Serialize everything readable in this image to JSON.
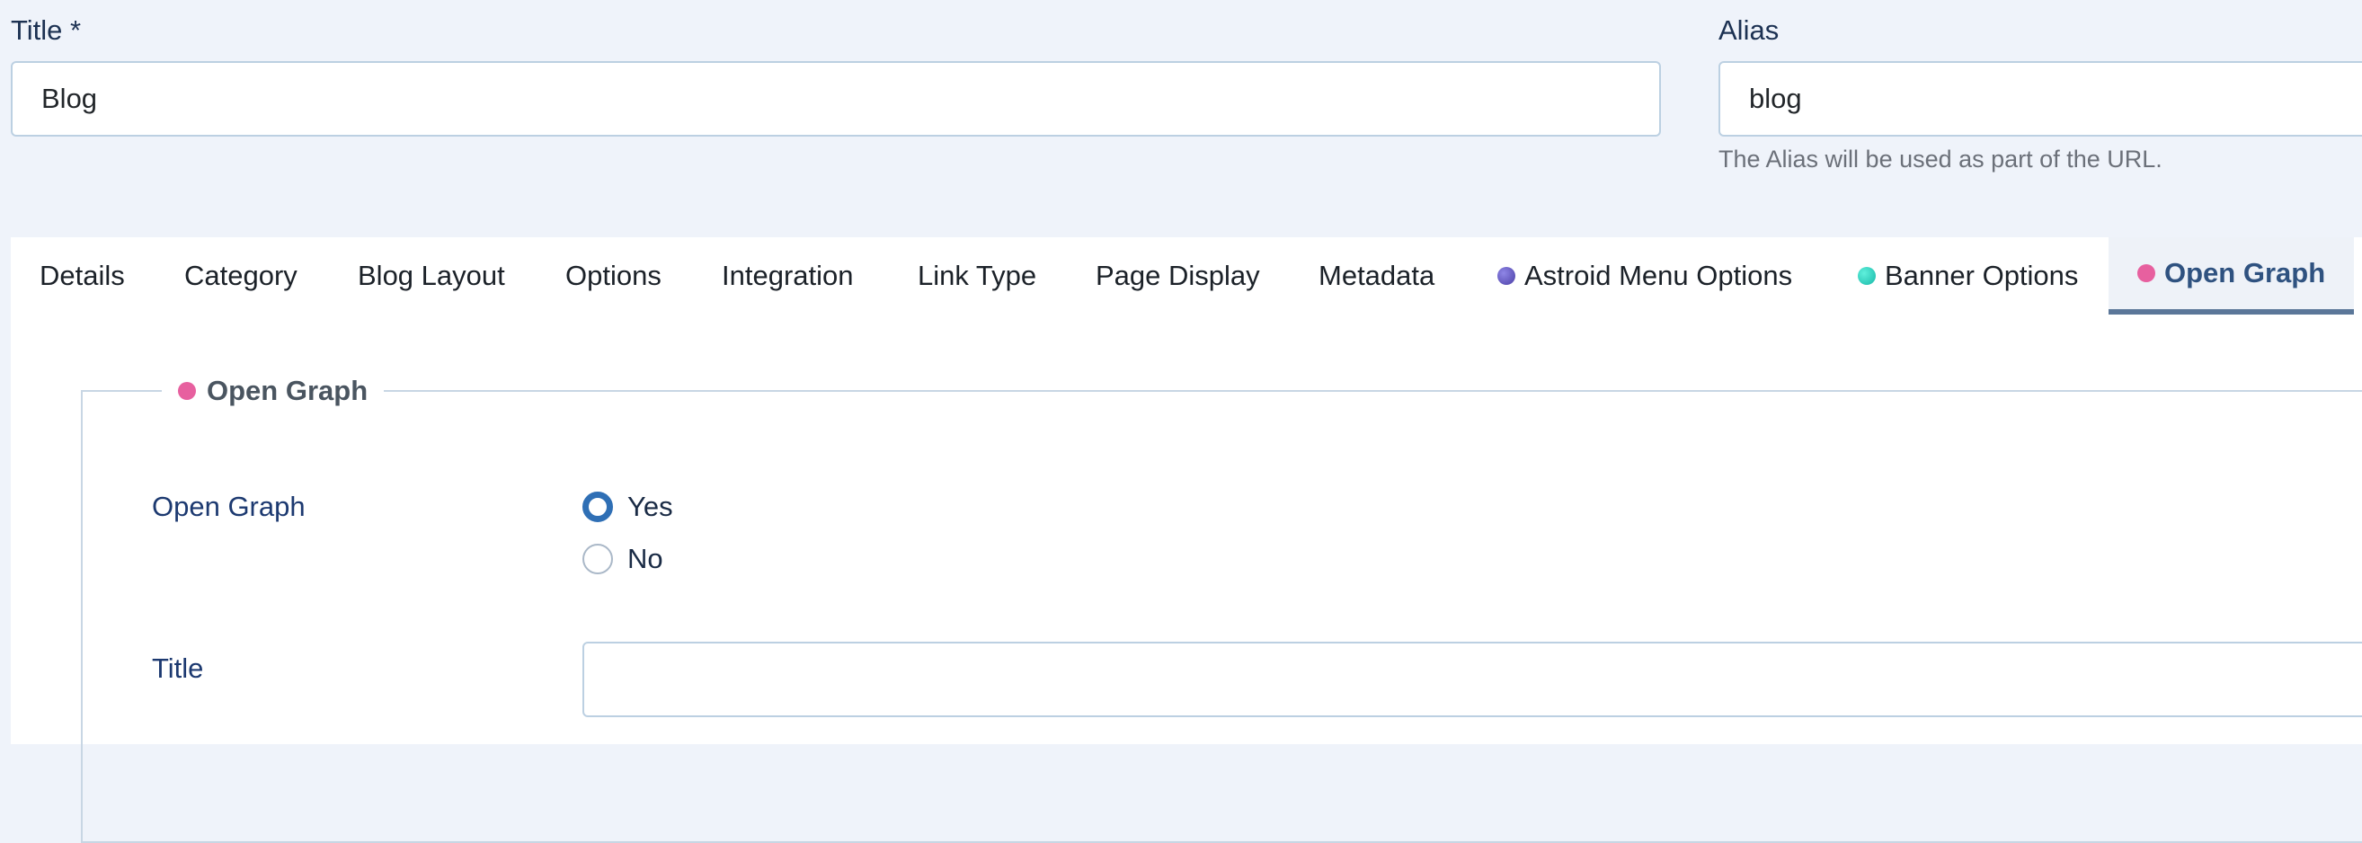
{
  "title_field": {
    "label": "Title *",
    "value": "Blog"
  },
  "alias_field": {
    "label": "Alias",
    "value": "blog",
    "help": "The Alias will be used as part of the URL."
  },
  "tabs": [
    {
      "label": "Details"
    },
    {
      "label": "Category"
    },
    {
      "label": "Blog Layout"
    },
    {
      "label": "Options"
    },
    {
      "label": "Integration"
    },
    {
      "label": "Link Type"
    },
    {
      "label": "Page Display"
    },
    {
      "label": "Metadata"
    },
    {
      "label": "Astroid Menu Options",
      "dot_color": "#6a5fc1"
    },
    {
      "label": "Banner Options",
      "dot_color": "#2fd3c0"
    },
    {
      "label": "Open Graph",
      "dot_color": "#e7609f",
      "active": true
    }
  ],
  "panel": {
    "legend": "Open Graph",
    "legend_dot_color": "#e7609f",
    "open_graph": {
      "label": "Open Graph",
      "options": [
        {
          "label": "Yes",
          "checked": true
        },
        {
          "label": "No",
          "checked": false
        }
      ]
    },
    "og_title": {
      "label": "Title",
      "value": ""
    }
  },
  "colors": {
    "background": "#eff3fa",
    "accent": "#2f6fb5",
    "active_tab_text": "#2f5280",
    "label_text": "#1c3970"
  }
}
